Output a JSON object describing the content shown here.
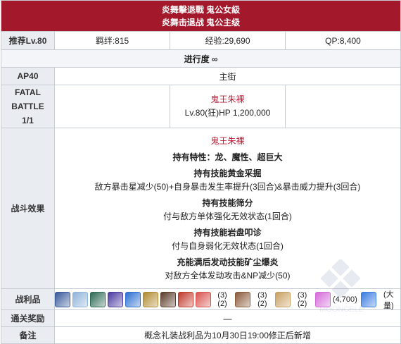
{
  "title": {
    "line1": "炎舞擊退戰 鬼公女級",
    "line2": "炎舞击退战 鬼公主级"
  },
  "row_info": {
    "label": "推荐Lv.80",
    "bond": "羁绊:815",
    "exp": "经验:29,690",
    "qp": "QP:8,400"
  },
  "progress": "进行度 ∞",
  "ap": {
    "label": "AP40",
    "location": "主街"
  },
  "fatal": {
    "label_line1": "FATAL",
    "label_line2": "BATTLE",
    "label_line3": "1/1",
    "enemy_name": "鬼王朱裸",
    "enemy_stats": "Lv.80(狂)HP 1,200,000"
  },
  "effects": {
    "label": "战斗效果",
    "enemy_name": "鬼王朱裸",
    "traits": "持有特性：龙、魔性、超巨大",
    "skill1_title": "持有技能黄金采掘",
    "skill1_desc": "敌方暴击星减少(50)+自身暴击发生率提升(3回合)&暴击威力提升(3回合)",
    "skill2_title": "持有技能筛分",
    "skill2_desc": "付与敌方单体强化无效状态(1回合)",
    "skill3_title": "持有技能岩盘叩诊",
    "skill3_desc": "付与自身弱化无效状态(1回合)",
    "charge_title": "充能满后发动技能矿尘爆炎",
    "charge_desc": "对敌方全体发动攻击&NP减少(50)"
  },
  "drops": {
    "label": "战利品",
    "items": [
      {
        "icon": "craft-essence-1",
        "color": "#3a5a9a",
        "count": ""
      },
      {
        "icon": "craft-essence-2",
        "color": "#8fb3d9",
        "count": ""
      },
      {
        "icon": "craft-essence-3",
        "color": "#2e6a55",
        "count": ""
      },
      {
        "icon": "craft-essence-4",
        "color": "#4a3aa0",
        "count": ""
      },
      {
        "icon": "blue-gem-icon",
        "color": "#2b6fd1",
        "count": ""
      },
      {
        "icon": "gold-ornament-icon",
        "color": "#b08a2e",
        "count": ""
      },
      {
        "icon": "feather-icon",
        "color": "#5b3b2a",
        "count": ""
      },
      {
        "icon": "red-seal-icon",
        "color": "#c0392b",
        "count": ""
      },
      {
        "icon": "event-item-a-icon",
        "color": "#d9534f",
        "count": "(3)(2)"
      },
      {
        "icon": "event-item-b-icon",
        "color": "#8a5a3a",
        "count": "(3)(2)"
      },
      {
        "icon": "event-item-c-icon",
        "color": "#c8a060",
        "count": "(3)(2)"
      },
      {
        "icon": "qp-orb-icon",
        "color": "#d46ad9",
        "count": "(4,700)"
      },
      {
        "icon": "crystal-icon",
        "color": "#3a7be0",
        "count": "(大量)"
      }
    ]
  },
  "clear_reward": {
    "label": "通关奖励",
    "value": "—"
  },
  "note": {
    "label": "备注",
    "value": "概念礼装战利品为10月30日19:00修正后新增"
  },
  "watermark": {
    "text": "MOONCELL"
  }
}
